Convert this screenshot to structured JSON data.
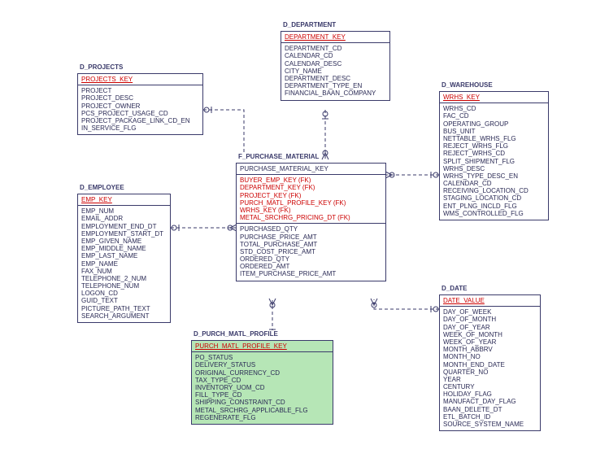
{
  "diagram": {
    "entities": {
      "projects": {
        "title": "D_PROJECTS",
        "pk": "PROJECTS_KEY",
        "cols": [
          "PROJECT",
          "PROJECT_DESC",
          "PROJECT_OWNER",
          "PCS_PROJECT_USAGE_CD",
          "PROJECT_PACKAGE_LINK_CD_EN",
          "IN_SERVICE_FLG"
        ]
      },
      "department": {
        "title": "D_DEPARTMENT",
        "pk": "DEPARTMENT_KEY",
        "cols": [
          "DEPARTMENT_CD",
          "CALENDAR_CD",
          "CALENDAR_DESC",
          "CITY_NAME",
          "DEPARTMENT_DESC",
          "DEPARTMENT_TYPE_EN",
          "FINANCIAL_BAAN_COMPANY"
        ]
      },
      "warehouse": {
        "title": "D_WAREHOUSE",
        "pk": "WRHS_KEY",
        "cols": [
          "WRHS_CD",
          "FAC_CD",
          "OPERATING_GROUP",
          "BUS_UNIT",
          "NETTABLE_WRHS_FLG",
          "REJECT_WRHS_FLG",
          "REJECT_WRHS_CD",
          "SPLIT_SHIPMENT_FLG",
          "WRHS_DESC",
          "WRHS_TYPE_DESC_EN",
          "CALENDAR_CD",
          "RECEIVING_LOCATION_CD",
          "STAGING_LOCATION_CD",
          "ENT_PLNG_INCLD_FLG",
          "WMS_CONTROLLED_FLG"
        ]
      },
      "employee": {
        "title": "D_EMPLOYEE",
        "pk": "EMP_KEY",
        "cols": [
          "EMP_NUM",
          "EMAIL_ADDR",
          "EMPLOYMENT_END_DT",
          "EMPLOYMENT_START_DT",
          "EMP_GIVEN_NAME",
          "EMP_MIDDLE_NAME",
          "EMP_LAST_NAME",
          "EMP_NAME",
          "FAX_NUM",
          "TELEPHONE_2_NUM",
          "TELEPHONE_NUM",
          "LOGON_CD",
          "GUID_TEXT",
          "PICTURE_PATH_TEXT",
          "SEARCH_ARGUMENT"
        ]
      },
      "purchase_material": {
        "title": "F_PURCHASE_MATERIAL",
        "pk": "PURCHASE_MATERIAL_KEY",
        "fks": [
          "BUYER_EMP_KEY (FK)",
          "DEPARTMENT_KEY (FK)",
          "PROJECT_KEY (FK)",
          "PURCH_MATL_PROFILE_KEY (FK)",
          "WRHS_KEY (FK)",
          "METAL_SRCHRG_PRICING_DT (FK)"
        ],
        "cols": [
          "PURCHASED_QTY",
          "PURCHASE_PRICE_AMT",
          "TOTAL_PURCHASE_AMT",
          "STD_COST_PRICE_AMT",
          "ORDERED_QTY",
          "ORDERED_AMT",
          "ITEM_PURCHASE_PRICE_AMT"
        ]
      },
      "purch_matl_profile": {
        "title": "D_PURCH_MATL_PROFILE",
        "pk": "PURCH_MATL_PROFILE_KEY",
        "cols": [
          "PO_STATUS",
          "DELIVERY_STATUS",
          "ORIGINAL_CURRENCY_CD",
          "TAX_TYPE_CD",
          "INVENTORY_UOM_CD",
          "FILL_TYPE_CD",
          "SHIPPING_CONSTRAINT_CD",
          "METAL_SRCHRG_APPLICABLE_FLG",
          "REGENERATE_FLG"
        ]
      },
      "date": {
        "title": "D_DATE",
        "pk": "DATE_VALUE",
        "cols": [
          "DAY_OF_WEEK",
          "DAY_OF_MONTH",
          "DAY_OF_YEAR",
          "WEEK_OF_MONTH",
          "WEEK_OF_YEAR",
          "MONTH_ABBRV",
          "MONTH_NO",
          "MONTH_END_DATE",
          "QUARTER_NO",
          "YEAR",
          "CENTURY",
          "HOLIDAY_FLAG",
          "MANUFACT_DAY_FLAG",
          "BAAN_DELETE_DT",
          "ETL_BATCH_ID",
          "SOURCE_SYSTEM_NAME"
        ]
      }
    }
  }
}
